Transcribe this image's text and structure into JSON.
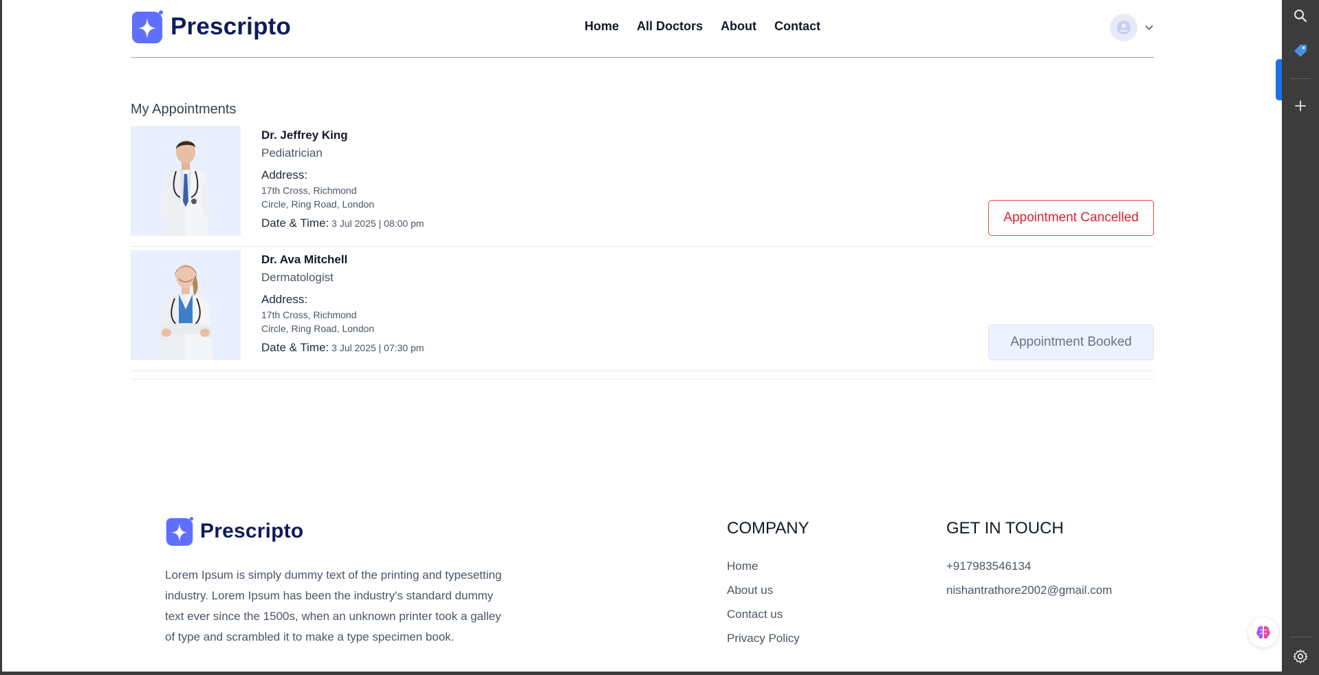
{
  "header": {
    "brand": "Prescripto",
    "nav": [
      {
        "label": "Home"
      },
      {
        "label": "All Doctors"
      },
      {
        "label": "About"
      },
      {
        "label": "Contact"
      }
    ]
  },
  "main": {
    "title": "My Appointments",
    "appointments": [
      {
        "name": "Dr. Jeffrey King",
        "speciality": "Pediatrician",
        "address_label": "Address:",
        "address_line1": "17th Cross, Richmond",
        "address_line2": "Circle, Ring Road, London",
        "datetime_label": "Date & Time:",
        "datetime": "3 Jul 2025 | 08:00 pm",
        "status": "Appointment Cancelled"
      },
      {
        "name": "Dr. Ava Mitchell",
        "speciality": "Dermatologist",
        "address_label": "Address:",
        "address_line1": "17th Cross, Richmond",
        "address_line2": "Circle, Ring Road, London",
        "datetime_label": "Date & Time:",
        "datetime": "3 Jul 2025 | 07:30 pm",
        "status": "Appointment Booked"
      }
    ]
  },
  "footer": {
    "brand": "Prescripto",
    "description": "Lorem Ipsum is simply dummy text of the printing and typesetting industry. Lorem Ipsum has been the industry's standard dummy text ever since the 1500s, when an unknown printer took a galley of type and scrambled it to make a type specimen book.",
    "company_heading": "COMPANY",
    "company_links": [
      {
        "label": "Home"
      },
      {
        "label": "About us"
      },
      {
        "label": "Contact us"
      },
      {
        "label": "Privacy Policy"
      }
    ],
    "touch_heading": "GET IN TOUCH",
    "phone": "+917983546134",
    "email": "nishantrathore2002@gmail.com"
  },
  "colors": {
    "brand_primary": "#5f6fff",
    "brand_text": "#0f1b5c",
    "cancelled": "#e11d2e",
    "browser_sidebar": "#3c3c3c"
  },
  "icons": {
    "sidebar": [
      "search-icon",
      "tag-icon",
      "plus-icon",
      "gear-icon"
    ],
    "floating": "brain-icon"
  }
}
